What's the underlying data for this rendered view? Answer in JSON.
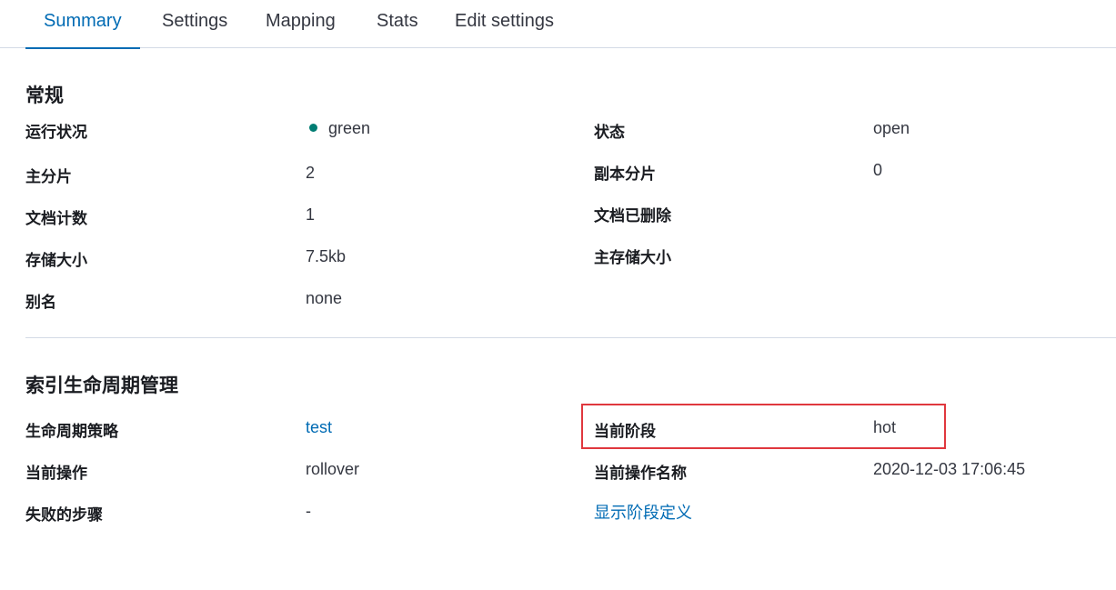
{
  "tabs": [
    {
      "label": "Summary"
    },
    {
      "label": "Settings"
    },
    {
      "label": "Mapping"
    },
    {
      "label": "Stats"
    },
    {
      "label": "Edit settings"
    }
  ],
  "general": {
    "title": "常规",
    "health_label": "运行状况",
    "health_value": "green",
    "health_color": "#017d73",
    "status_label": "状态",
    "status_value": "open",
    "primaries_label": "主分片",
    "primaries_value": "2",
    "replicas_label": "副本分片",
    "replicas_value": "0",
    "docs_count_label": "文档计数",
    "docs_count_value": "1",
    "docs_deleted_label": "文档已删除",
    "storage_size_label": "存储大小",
    "storage_size_value": "7.5kb",
    "primary_storage_label": "主存储大小",
    "aliases_label": "别名",
    "aliases_value": "none"
  },
  "ilm": {
    "title": "索引生命周期管理",
    "policy_label": "生命周期策略",
    "policy_value": "test",
    "phase_label": "当前阶段",
    "phase_value": "hot",
    "action_label": "当前操作",
    "action_value": "rollover",
    "action_time_label": "当前操作名称",
    "action_time_value": "2020-12-03 17:06:45",
    "failed_step_label": "失败的步骤",
    "failed_step_value": "-",
    "show_phase_def_link": "显示阶段定义"
  }
}
